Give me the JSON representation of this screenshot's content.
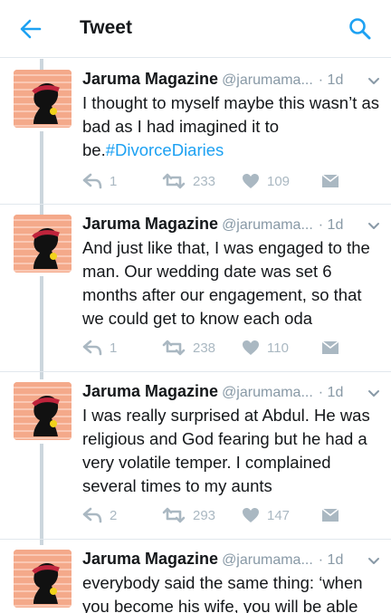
{
  "header": {
    "title": "Tweet"
  },
  "colors": {
    "accent": "#1da1f2",
    "muted": "#aab8c2"
  },
  "icons": {
    "back": "arrow-left-icon",
    "search": "search-icon",
    "reply": "reply-icon",
    "retweet": "retweet-icon",
    "like": "heart-icon",
    "dm": "envelope-icon",
    "menu": "chevron-down-icon"
  },
  "tweets": [
    {
      "name": "Jaruma Magazine",
      "handle": "@jarumama...",
      "time": "· 1d",
      "text_before": "I thought to myself maybe this wasn’t as bad as I had imagined it to be.",
      "hashtag": "#DivorceDiaries",
      "text_after": "",
      "replies": "1",
      "retweets": "233",
      "likes": "109"
    },
    {
      "name": "Jaruma Magazine",
      "handle": "@jarumama...",
      "time": "· 1d",
      "text_before": "And just like that, I was engaged to the man. Our wedding date was set 6 months after our engagement, so that we could get to know each oda",
      "hashtag": "",
      "text_after": "",
      "replies": "1",
      "retweets": "238",
      "likes": "110"
    },
    {
      "name": "Jaruma Magazine",
      "handle": "@jarumama...",
      "time": "· 1d",
      "text_before": "I was really surprised at Abdul. He was religious and God fearing but he had a very volatile temper. I complained several times to my aunts",
      "hashtag": "",
      "text_after": "",
      "replies": "2",
      "retweets": "293",
      "likes": "147"
    },
    {
      "name": "Jaruma Magazine",
      "handle": "@jarumama...",
      "time": "· 1d",
      "text_before": "everybody said the same thing: ‘when you become his wife, you will be able",
      "hashtag": "",
      "text_after": "",
      "replies": "",
      "retweets": "",
      "likes": ""
    }
  ]
}
